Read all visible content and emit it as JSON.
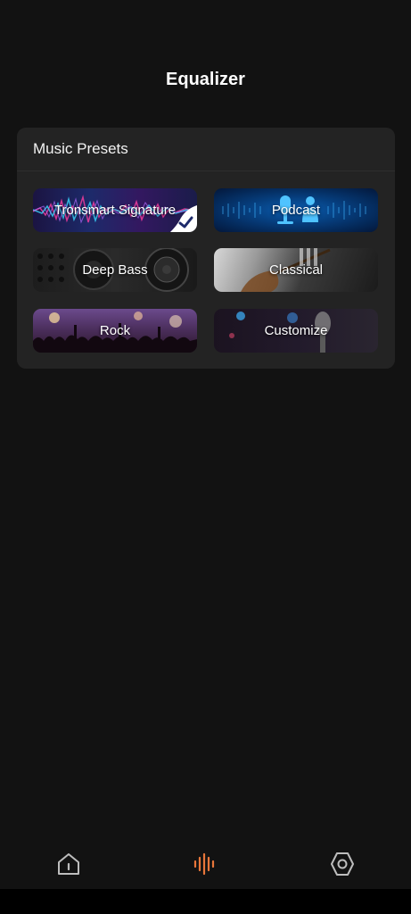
{
  "header": {
    "title": "Equalizer"
  },
  "presets": {
    "section_title": "Music Presets",
    "items": [
      {
        "label": "Tronsmart Signature",
        "selected": true
      },
      {
        "label": "Podcast",
        "selected": false
      },
      {
        "label": "Deep Bass",
        "selected": false
      },
      {
        "label": "Classical",
        "selected": false
      },
      {
        "label": "Rock",
        "selected": false
      },
      {
        "label": "Customize",
        "selected": false
      }
    ]
  },
  "bottom_nav": {
    "items": [
      {
        "icon": "home-icon"
      },
      {
        "icon": "equalizer-icon",
        "active": true
      },
      {
        "icon": "settings-icon"
      }
    ],
    "active_color": "#e8763a",
    "inactive_color": "#bdbdbd"
  }
}
